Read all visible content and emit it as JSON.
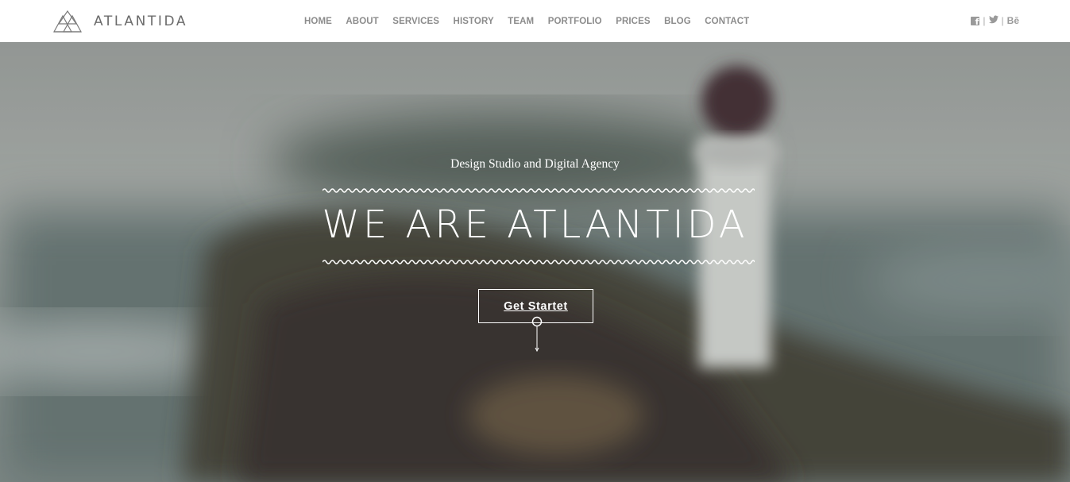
{
  "brand": {
    "name": "ATLANTIDA",
    "logo_icon": "triangles-logo-icon"
  },
  "nav": {
    "items": [
      {
        "label": "HOME"
      },
      {
        "label": "ABOUT"
      },
      {
        "label": "SERVICES"
      },
      {
        "label": "HISTORY"
      },
      {
        "label": "TEAM"
      },
      {
        "label": "PORTFOLIO"
      },
      {
        "label": "PRICES"
      },
      {
        "label": "BLOG"
      },
      {
        "label": "CONTACT"
      }
    ]
  },
  "social": {
    "icons": [
      "facebook-icon",
      "twitter-icon",
      "behance-icon"
    ],
    "separator": "|",
    "behance_label": "Bē"
  },
  "hero": {
    "tagline": "Design Studio and Digital Agency",
    "title": "WE ARE ATLANTIDA",
    "cta_label": "Get Startet",
    "scroll_icon": "scroll-down-icon"
  },
  "colors": {
    "header_bg": "#ffffff",
    "nav_text": "#8c8c8c",
    "hero_text": "#ffffff"
  }
}
